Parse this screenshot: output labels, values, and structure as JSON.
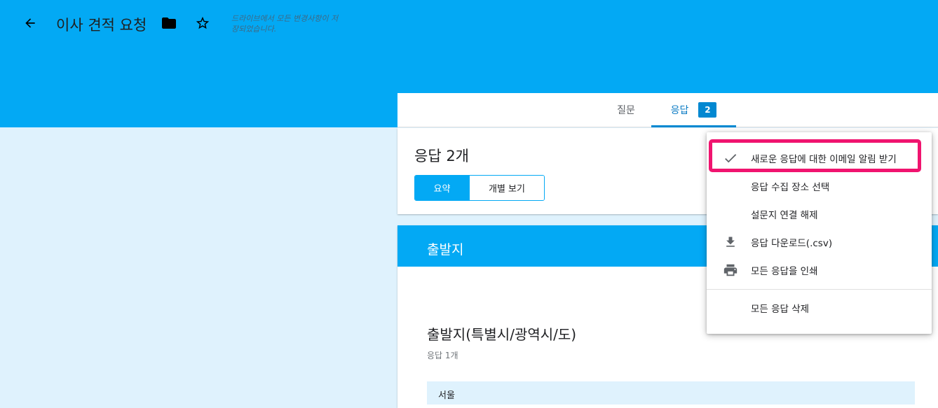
{
  "header": {
    "title": "이사 견적 요청",
    "save_status": "드라이브에서 모든 변경사항이 저장되었습니다."
  },
  "tabs": {
    "questions": "질문",
    "responses": "응답",
    "responses_count": "2"
  },
  "responses": {
    "title": "응답 2개",
    "summary_label": "요약",
    "individual_label": "개별 보기"
  },
  "question": {
    "section_title": "출발지",
    "title": "출발지(특별시/광역시/도)",
    "response_count": "응답 1개",
    "answers": [
      "서울"
    ]
  },
  "menu": {
    "items": [
      {
        "label": "새로운 응답에 대한 이메일 알림 받기",
        "icon": "check-icon",
        "checked": true
      },
      {
        "label": "응답 수집 장소 선택",
        "icon": ""
      },
      {
        "label": "설문지 연결 해제",
        "icon": ""
      },
      {
        "label": "응답 다운로드(.csv)",
        "icon": "download-icon"
      },
      {
        "label": "모든 응답을 인쇄",
        "icon": "print-icon"
      },
      {
        "label": "모든 응답 삭제",
        "icon": ""
      }
    ]
  },
  "colors": {
    "primary": "#03a9f4",
    "light_bg": "#dff2fd",
    "highlight": "#f0146f"
  }
}
